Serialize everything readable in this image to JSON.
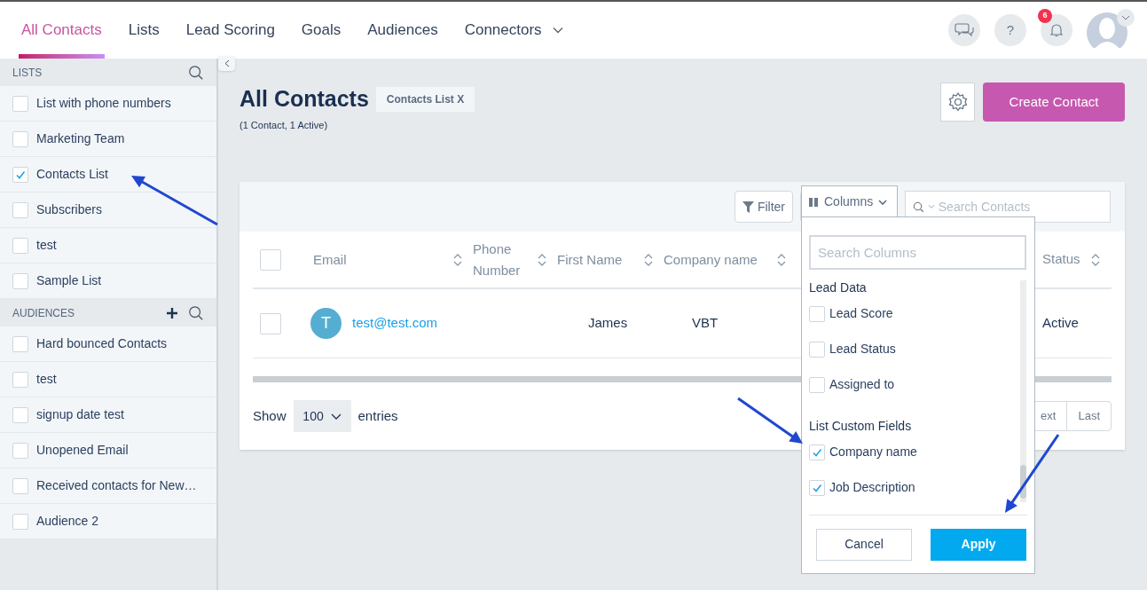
{
  "nav": {
    "tabs": [
      {
        "label": "All Contacts",
        "selected": true,
        "caret": false
      },
      {
        "label": "Lists",
        "selected": false,
        "caret": false
      },
      {
        "label": "Lead Scoring",
        "selected": false,
        "caret": false
      },
      {
        "label": "Goals",
        "selected": false,
        "caret": false
      },
      {
        "label": "Audiences",
        "selected": false,
        "caret": false
      },
      {
        "label": "Connectors",
        "selected": false,
        "caret": true
      }
    ],
    "help": "?",
    "notification_count": "6"
  },
  "sidebar": {
    "sections": [
      {
        "title": "LISTS",
        "add": false,
        "items": [
          {
            "label": "List with phone numbers",
            "checked": false
          },
          {
            "label": "Marketing Team",
            "checked": false
          },
          {
            "label": "Contacts List",
            "checked": true
          },
          {
            "label": "Subscribers",
            "checked": false
          },
          {
            "label": "test",
            "checked": false
          },
          {
            "label": "Sample List",
            "checked": false
          }
        ]
      },
      {
        "title": "AUDIENCES",
        "add": true,
        "items": [
          {
            "label": "Hard bounced Contacts",
            "checked": false
          },
          {
            "label": "test",
            "checked": false
          },
          {
            "label": "signup date test",
            "checked": false
          },
          {
            "label": "Unopened Email",
            "checked": false
          },
          {
            "label": "Received contacts for New…",
            "checked": false
          },
          {
            "label": "Audience 2",
            "checked": false
          }
        ]
      }
    ]
  },
  "page": {
    "title": "All Contacts",
    "chip": "Contacts List X",
    "subtitle": "(1 Contact, 1 Active)",
    "create_button": "Create Contact"
  },
  "toolbar": {
    "filter": "Filter",
    "columns": "Columns",
    "search_placeholder": "Search Contacts"
  },
  "table": {
    "select_all_checked": false,
    "columns": [
      {
        "label": "Email"
      },
      {
        "label": "Phone Number"
      },
      {
        "label": "First Name"
      },
      {
        "label": "Company name"
      },
      {
        "label": "Status"
      }
    ],
    "rows": [
      {
        "checked": false,
        "initial": "T",
        "email": "test@test.com",
        "first_name": "James",
        "company": "VBT",
        "status": "Active"
      }
    ]
  },
  "entries": {
    "show": "Show",
    "value": "100",
    "suffix": "entries"
  },
  "pagination": [
    "ext",
    "Last"
  ],
  "columns_menu": {
    "search_placeholder": "Search Columns",
    "groups": [
      {
        "title": "Lead Data",
        "items": [
          {
            "label": "Lead Score",
            "checked": false
          },
          {
            "label": "Lead Status",
            "checked": false
          },
          {
            "label": "Assigned to",
            "checked": false
          }
        ]
      },
      {
        "title": "List Custom Fields",
        "items": [
          {
            "label": "Company name",
            "checked": true
          },
          {
            "label": "Job Description",
            "checked": true
          }
        ]
      }
    ],
    "cancel": "Cancel",
    "apply": "Apply"
  }
}
